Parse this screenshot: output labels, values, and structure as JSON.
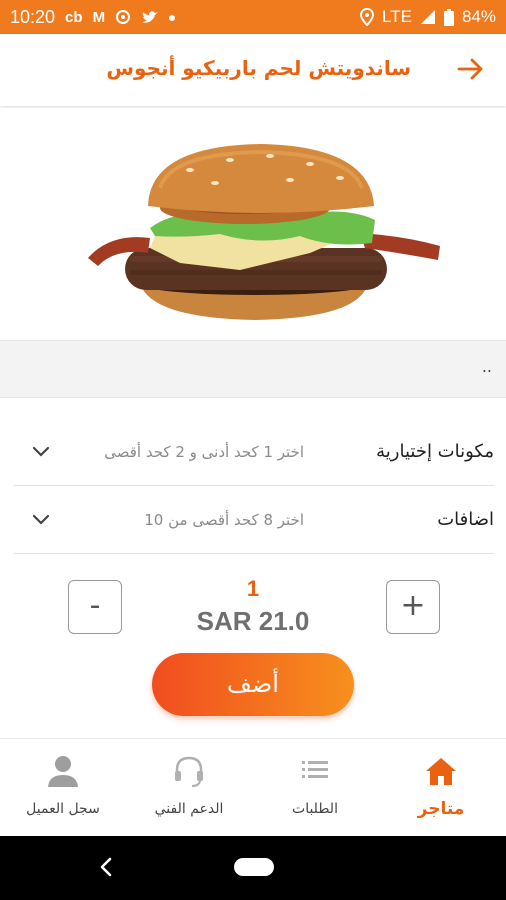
{
  "status_bar": {
    "time": "10:20",
    "icon_glyphs": [
      "cb",
      "M"
    ],
    "network": "LTE",
    "battery": "84%"
  },
  "header": {
    "title": "ساندويتش لحم باربيكيو أنجوس"
  },
  "product": {
    "description": ".."
  },
  "options": [
    {
      "label": "مكونات إختيارية",
      "hint": "اختر 1 كحد أدنى و 2 كحد أقصى"
    },
    {
      "label": "اضافات",
      "hint": "اختر 8 كحد أقصى من 10"
    }
  ],
  "quantity": {
    "minus_label": "-",
    "plus_label": "+",
    "value": "1",
    "price": "SAR 21.0"
  },
  "add_button": {
    "label": "أضف"
  },
  "bottom_nav": [
    {
      "label": "متاجر",
      "icon": "home-icon",
      "active": true
    },
    {
      "label": "الطلبات",
      "icon": "list-icon",
      "active": false
    },
    {
      "label": "الدعم الفني",
      "icon": "headset-icon",
      "active": false
    },
    {
      "label": "سجل العميل",
      "icon": "person-icon",
      "active": false
    }
  ],
  "colors": {
    "accent": "#e8620f",
    "status_bar": "#f07a1e",
    "button_gradient_start": "#f14d1f",
    "button_gradient_end": "#f7901e"
  }
}
